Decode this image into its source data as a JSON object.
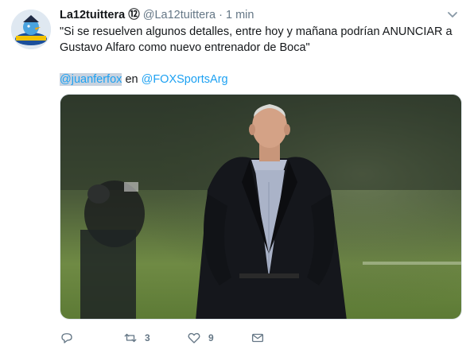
{
  "tweet": {
    "author_name": "La12tuittera",
    "author_badge": "⑫",
    "author_handle": "@La12tuittera",
    "separator": "·",
    "time": "1 min",
    "text_line1": "\"Si se resuelven algunos detalles, entre hoy y mañana podrían ANUNCIAR a",
    "text_line2": "Gustavo Alfaro como nuevo entrenador de Boca\"",
    "mention1": "@juanferfox",
    "mention_joiner": "en",
    "mention2": "@FOXSportsArg"
  },
  "actions": {
    "reply_count": "",
    "retweet_count": "3",
    "like_count": "9"
  },
  "icons": {
    "caret": "chevron-down-icon",
    "reply": "reply-icon",
    "retweet": "retweet-icon",
    "like": "heart-icon",
    "dm": "envelope-icon"
  },
  "colors": {
    "link": "#1da1f2",
    "muted": "#657786",
    "text": "#14171a"
  }
}
